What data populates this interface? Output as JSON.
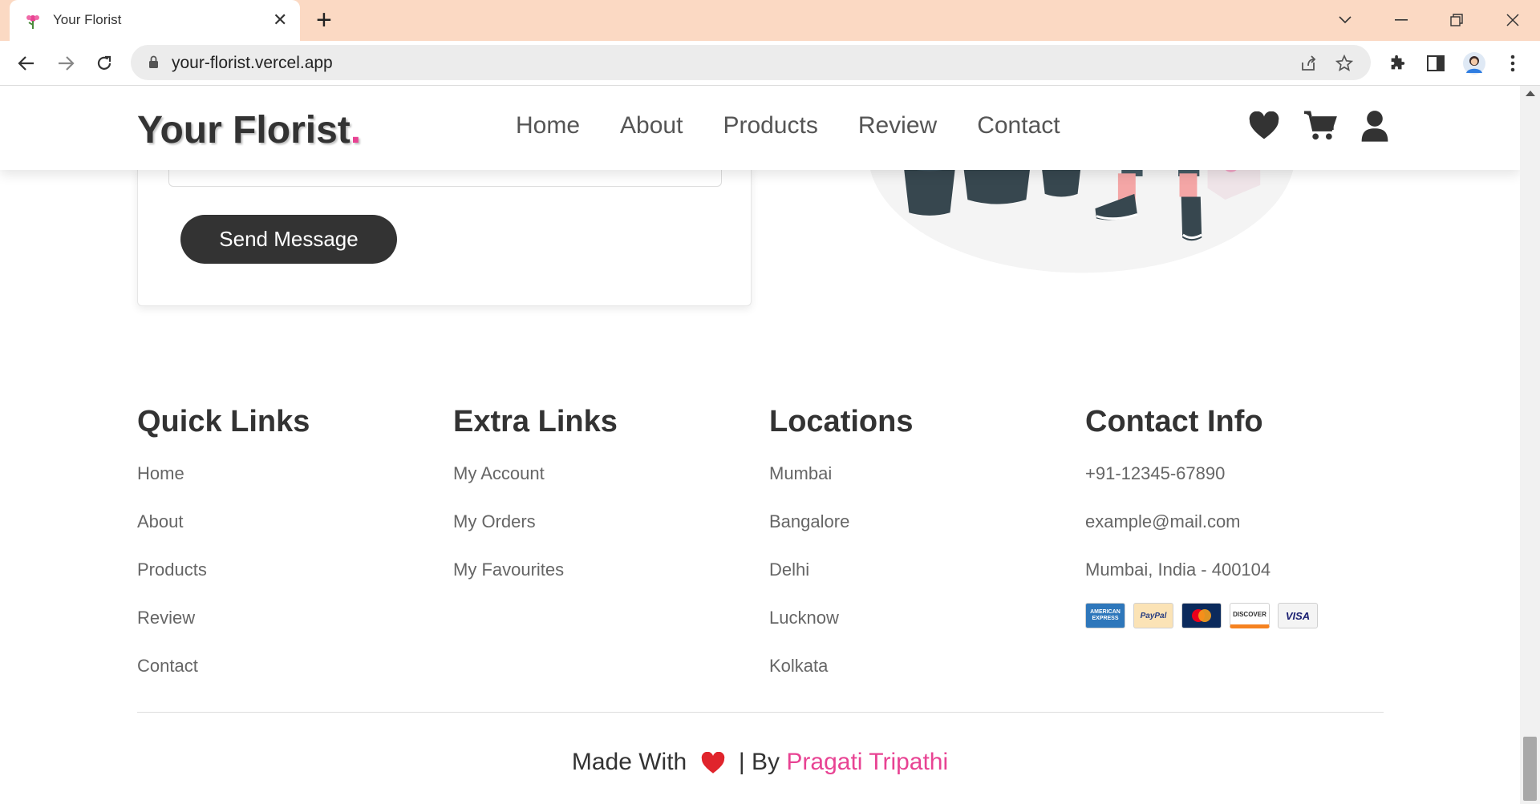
{
  "browser": {
    "tab_title": "Your Florist",
    "url": "your-florist.vercel.app"
  },
  "site": {
    "logo_text": "Your Florist",
    "logo_dot": ".",
    "nav": [
      "Home",
      "About",
      "Products",
      "Review",
      "Contact"
    ]
  },
  "form": {
    "send_label": "Send Message"
  },
  "footer": {
    "quick_links": {
      "title": "Quick Links",
      "items": [
        "Home",
        "About",
        "Products",
        "Review",
        "Contact"
      ]
    },
    "extra_links": {
      "title": "Extra Links",
      "items": [
        "My Account",
        "My Orders",
        "My Favourites"
      ]
    },
    "locations": {
      "title": "Locations",
      "items": [
        "Mumbai",
        "Bangalore",
        "Delhi",
        "Lucknow",
        "Kolkata"
      ]
    },
    "contact": {
      "title": "Contact Info",
      "phone": "+91-12345-67890",
      "email": "example@mail.com",
      "address": "Mumbai, India - 400104",
      "payments": [
        "AMERICAN EXPRESS",
        "PayPal",
        "MasterCard",
        "DISCOVER",
        "VISA"
      ]
    },
    "credit_prefix": "Made With",
    "credit_by": "| By",
    "credit_author": "Pragati Tripathi"
  },
  "colors": {
    "accent": "#e84393",
    "dark": "#333333",
    "tabbar": "#fbd9c3"
  }
}
